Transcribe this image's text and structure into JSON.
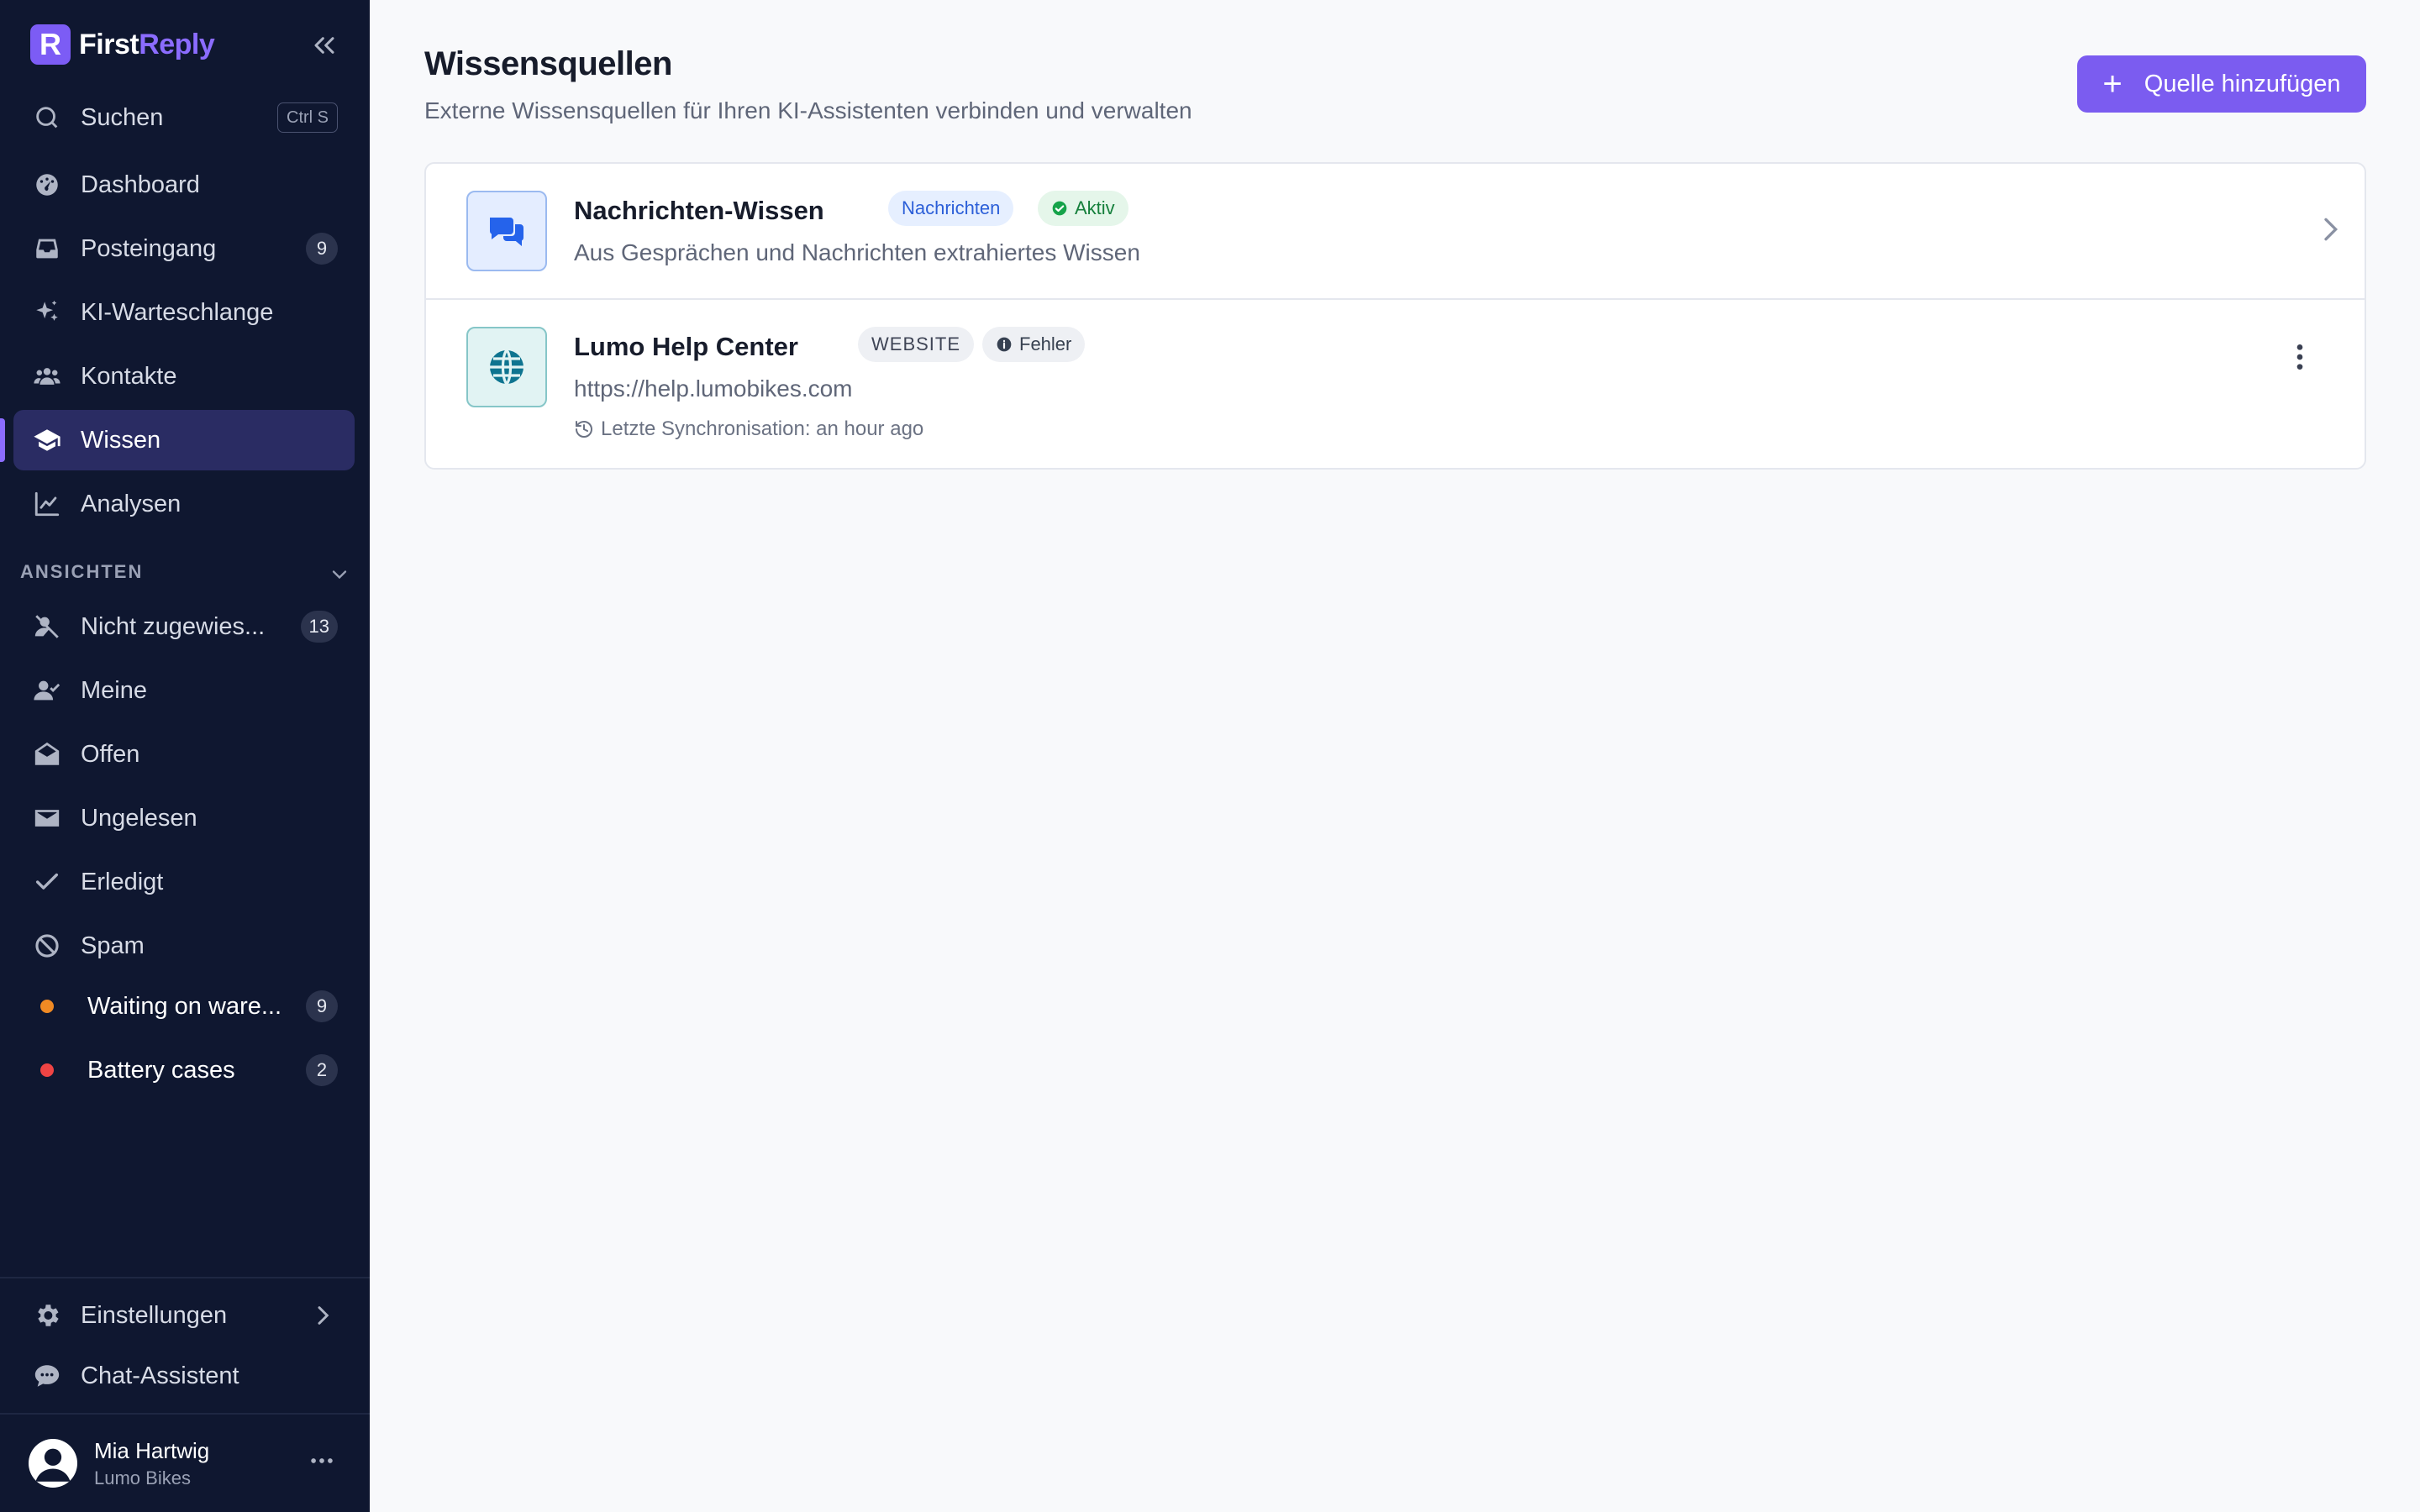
{
  "app": {
    "brand_first": "First",
    "brand_second": "Reply",
    "brand_logo_letter": "R"
  },
  "sidebar": {
    "search": {
      "label": "Suchen",
      "shortcut": "Ctrl S"
    },
    "items": [
      {
        "label": "Dashboard",
        "icon": "dashboard-icon"
      },
      {
        "label": "Posteingang",
        "icon": "inbox-icon",
        "count": "9"
      },
      {
        "label": "KI-Warteschlange",
        "icon": "sparkles-icon"
      },
      {
        "label": "Kontakte",
        "icon": "users-icon"
      },
      {
        "label": "Wissen",
        "icon": "graduation-cap-icon",
        "active": true
      },
      {
        "label": "Analysen",
        "icon": "line-chart-icon"
      }
    ],
    "views_label": "ANSICHTEN",
    "views": [
      {
        "label": "Nicht zugewies...",
        "icon": "user-off-icon",
        "count": "13"
      },
      {
        "label": "Meine",
        "icon": "user-check-icon"
      },
      {
        "label": "Offen",
        "icon": "envelope-open-icon"
      },
      {
        "label": "Ungelesen",
        "icon": "envelope-icon"
      },
      {
        "label": "Erledigt",
        "icon": "check-icon"
      },
      {
        "label": "Spam",
        "icon": "ban-icon"
      },
      {
        "label": "Waiting on ware...",
        "dot_color": "#f08a24",
        "count": "9"
      },
      {
        "label": "Battery cases",
        "dot_color": "#ef4444",
        "count": "2"
      }
    ],
    "settings_label": "Einstellungen",
    "chat_label": "Chat-Assistent",
    "user": {
      "name": "Mia Hartwig",
      "org": "Lumo Bikes"
    }
  },
  "main": {
    "title": "Wissensquellen",
    "subtitle": "Externe Wissensquellen für Ihren KI-Assistenten verbinden und verwalten",
    "add_button": "Quelle hinzufügen",
    "sources": [
      {
        "title": "Nachrichten-Wissen",
        "type_badge": "Nachrichten",
        "status": "Aktiv",
        "description": "Aus Gesprächen und Nachrichten extrahiertes Wissen",
        "icon": "chat-bubbles-icon"
      },
      {
        "title": "Lumo Help Center",
        "type_badge": "WEBSITE",
        "status": "Fehler",
        "url": "https://help.lumobikes.com",
        "last_sync": "Letzte Synchronisation: an hour ago",
        "icon": "globe-icon"
      }
    ]
  },
  "colors": {
    "sidebar_bg": "#0f1730",
    "accent": "#7b5cf0",
    "active_item_bg": "#2a2c63",
    "status_active": "#16a34a",
    "status_error": "#374151"
  }
}
